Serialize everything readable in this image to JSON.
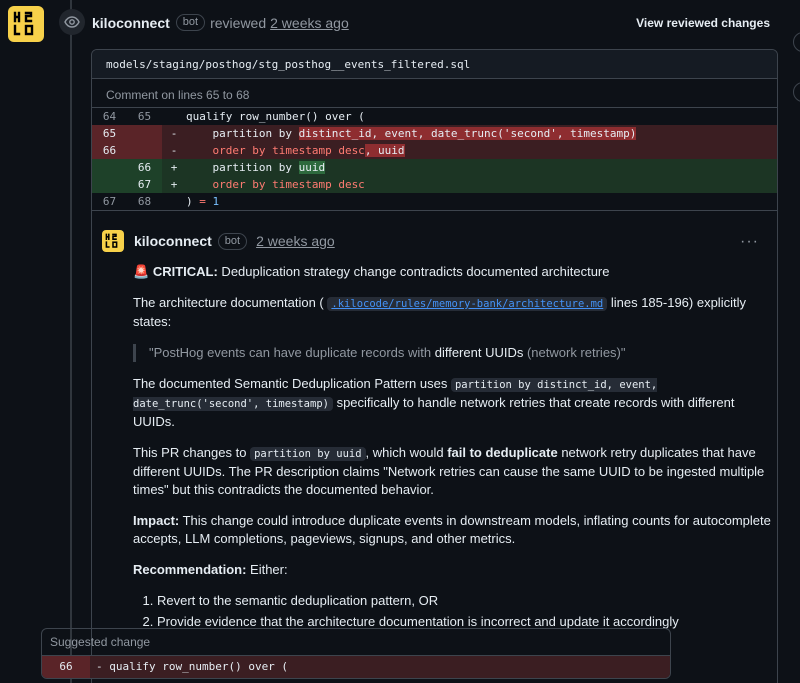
{
  "review": {
    "author": "kiloconnect",
    "bot_label": "bot",
    "action": "reviewed",
    "time_ago": "2 weeks ago",
    "view_changes_label": "View reviewed changes"
  },
  "thread": {
    "file_path": "models/staging/posthog/stg_posthog__events_filtered.sql",
    "comment_lines": "Comment on lines 65 to 68",
    "diff": [
      {
        "type": "ctx",
        "old": "64",
        "new": "65",
        "sign": "",
        "parts": [
          {
            "t": "qualify row_number() over ("
          }
        ]
      },
      {
        "type": "del",
        "old": "65",
        "new": "",
        "sign": "-",
        "parts": [
          {
            "t": "    partition by "
          },
          {
            "t": "distinct_id, event, date_trunc('second', timestamp)",
            "c": "hl-del"
          }
        ]
      },
      {
        "type": "del",
        "old": "66",
        "new": "",
        "sign": "-",
        "parts": [
          {
            "t": "    order by timestamp desc",
            "c": "kw"
          },
          {
            "t": ", uuid",
            "c": "hl-del"
          }
        ]
      },
      {
        "type": "add",
        "old": "",
        "new": "66",
        "sign": "+",
        "parts": [
          {
            "t": "    partition by "
          },
          {
            "t": "uuid",
            "c": "hl-add"
          }
        ]
      },
      {
        "type": "add",
        "old": "",
        "new": "67",
        "sign": "+",
        "parts": [
          {
            "t": "    order by timestamp desc",
            "c": "kw"
          }
        ]
      },
      {
        "type": "ctx",
        "old": "67",
        "new": "68",
        "sign": "",
        "parts": [
          {
            "t": ") "
          },
          {
            "t": "=",
            "c": "kw"
          },
          {
            "t": " "
          },
          {
            "t": "1",
            "c": "num"
          }
        ]
      }
    ]
  },
  "comment": {
    "author": "kiloconnect",
    "bot_label": "bot",
    "time_ago": "2 weeks ago",
    "critical_emoji": "🚨",
    "critical_label": "CRITICAL:",
    "critical_text": " Deduplication strategy change contradicts documented architecture",
    "p1_before": "The architecture documentation (",
    "p1_link": ".kilocode/rules/memory-bank/architecture.md",
    "p1_after": " lines 185-196) explicitly states:",
    "quote_before": "\"PostHog events can have duplicate records with ",
    "quote_bold": "different UUIDs",
    "quote_after": " (network retries)\"",
    "p2_before": "The documented Semantic Deduplication Pattern uses ",
    "p2_code": "partition by distinct_id, event, date_trunc('second', timestamp)",
    "p2_after": " specifically to handle network retries that create records with different UUIDs.",
    "p3_before": "This PR changes to ",
    "p3_code": "partition by uuid",
    "p3_mid": ", which would ",
    "p3_bold": "fail to deduplicate",
    "p3_after": " network retry duplicates that have different UUIDs. The PR description claims \"Network retries can cause the same UUID to be ingested multiple times\" but this contradicts the documented behavior.",
    "impact_label": "Impact:",
    "impact_text": " This change could introduce duplicate events in downstream models, inflating counts for autocomplete accepts, LLM completions, pageviews, signups, and other metrics.",
    "rec_label": "Recommendation:",
    "rec_text": " Either:",
    "rec_items": [
      "Revert to the semantic deduplication pattern, OR",
      "Provide evidence that the architecture documentation is incorrect and update it accordingly"
    ],
    "suggested_label": "Suggested change",
    "suggested_line_no": "66",
    "suggested_line": "- qualify row_number() over ("
  },
  "colors": {
    "background": "#0d1117",
    "avatar": "#f7d14a",
    "link": "#4493f8",
    "deleted": "#3b1e22",
    "added": "#1c3524"
  },
  "icons": [
    "kilo-logo-icon",
    "eye-icon",
    "kebab-menu-icon"
  ]
}
